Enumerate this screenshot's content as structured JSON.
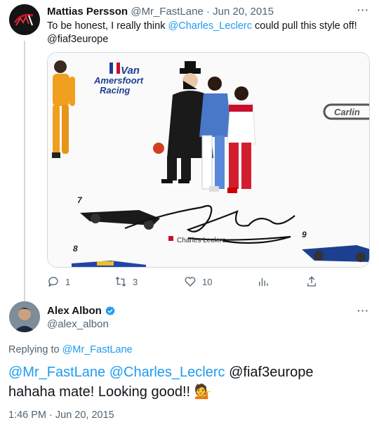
{
  "tweet1": {
    "author_name": "Mattias Persson",
    "author_handle": "@Mr_FastLane",
    "separator": " · ",
    "date": "Jun 20, 2015",
    "text_before": "To be honest, I really think ",
    "mention_link": "@Charles_Leclerc",
    "text_after": " could pull this style off!",
    "text_line2": "@fiaf3europe",
    "more_label": "···",
    "media": {
      "brand_logo_line1": "Van",
      "brand_logo_line2": "Amersfoort",
      "brand_logo_line3": "Racing",
      "sponsor_logo": "Carlin",
      "car_number_1": "7",
      "car_number_2": "8",
      "car_number_3": "9",
      "signature_caption": "Charles Leclerc"
    },
    "actions": {
      "reply_count": "1",
      "retweet_count": "3",
      "like_count": "10",
      "views_label": "",
      "share_label": ""
    }
  },
  "tweet2": {
    "author_name": "Alex Albon",
    "author_handle": "@alex_albon",
    "more_label": "···",
    "replying_prefix": "Replying to ",
    "replying_to": "@Mr_FastLane",
    "mention_1": "@Mr_FastLane",
    "mention_2": "@Charles_Leclerc",
    "mention_3_text": "@fiaf3europe",
    "body_line2": "hahaha mate! Looking good!! ",
    "emoji": "💁",
    "timestamp": "1:46 PM · Jun 20, 2015"
  },
  "colors": {
    "accent": "#1d9bf0",
    "muted": "#536471",
    "border": "#cfd9de",
    "verified": "#1d9bf0"
  }
}
